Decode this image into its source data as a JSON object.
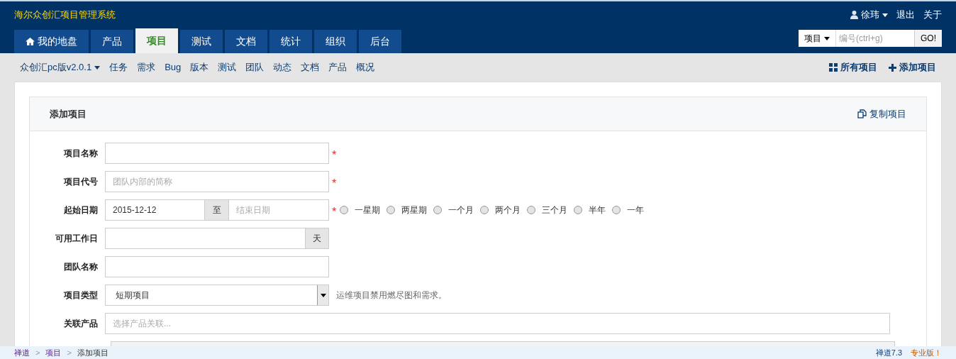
{
  "header": {
    "title": "海尔众创汇项目管理系统",
    "user": "徐玮",
    "links": [
      "退出",
      "关于"
    ],
    "search": {
      "scope": "项目",
      "placeholder": "编号(ctrl+g)",
      "button": "GO!"
    }
  },
  "main_tabs": [
    {
      "label": "我的地盘",
      "selected": false
    },
    {
      "label": "产品",
      "selected": false
    },
    {
      "label": "项目",
      "selected": true
    },
    {
      "label": "测试",
      "selected": false
    },
    {
      "label": "文档",
      "selected": false
    },
    {
      "label": "统计",
      "selected": false
    },
    {
      "label": "组织",
      "selected": false
    },
    {
      "label": "后台",
      "selected": false
    }
  ],
  "sub_nav": {
    "project": "众创汇pc版v2.0.1",
    "items": [
      "任务",
      "需求",
      "Bug",
      "版本",
      "测试",
      "团队",
      "动态",
      "文档",
      "产品",
      "概况"
    ],
    "actions": [
      {
        "label": "所有项目"
      },
      {
        "label": "添加项目"
      }
    ]
  },
  "card": {
    "title": "添加项目",
    "action": "复制项目"
  },
  "form": [
    {
      "kind": "text",
      "label": "项目名称",
      "required_mark": "*"
    },
    {
      "kind": "text",
      "label": "项目代号",
      "placeholder": "团队内部的简称",
      "required_mark": "*"
    },
    {
      "kind": "daterange",
      "label": "起始日期",
      "value": "2015-12-12",
      "separator": "至",
      "placeholder": "结束日期",
      "required_mark": "*",
      "options": [
        {
          "label": "一星期",
          "selected": false
        },
        {
          "label": "两星期",
          "selected": false
        },
        {
          "label": "一个月",
          "selected": false
        },
        {
          "label": "两个月",
          "selected": false
        },
        {
          "label": "三个月",
          "selected": false
        },
        {
          "label": "半年",
          "selected": false
        },
        {
          "label": "一年",
          "selected": false
        }
      ]
    },
    {
      "kind": "addon",
      "label": "可用工作日",
      "addon": "天"
    },
    {
      "kind": "text",
      "label": "团队名称"
    },
    {
      "kind": "select",
      "label": "项目类型",
      "value": "短期项目",
      "hint": "运维项目禁用燃尽图和需求。"
    },
    {
      "kind": "wide",
      "label": "关联产品",
      "placeholder": "选择产品关联..."
    }
  ],
  "footer": {
    "breadcrumb": [
      "禅道",
      "项目",
      "添加项目"
    ],
    "separators": [
      ">",
      ">"
    ],
    "right": [
      "禅道7.3",
      "专业版！"
    ]
  }
}
